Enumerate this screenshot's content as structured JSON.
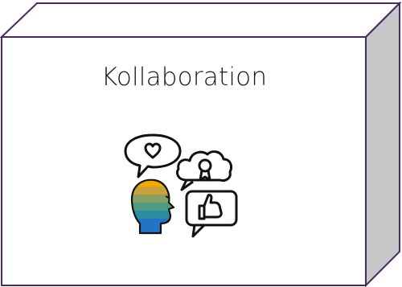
{
  "block": {
    "title": "Kollaboration",
    "icon": "collaboration-icon",
    "colors": {
      "border": "#4b2a5e",
      "front": "#ffffff",
      "top_side": "#ffffff",
      "right_side": "#c8c8c8",
      "icon_stroke": "#111111",
      "head_stripes": [
        "#f2a900",
        "#c9a33a",
        "#8aa062",
        "#4f9a82",
        "#2a8ea0",
        "#1f74c4"
      ]
    }
  }
}
